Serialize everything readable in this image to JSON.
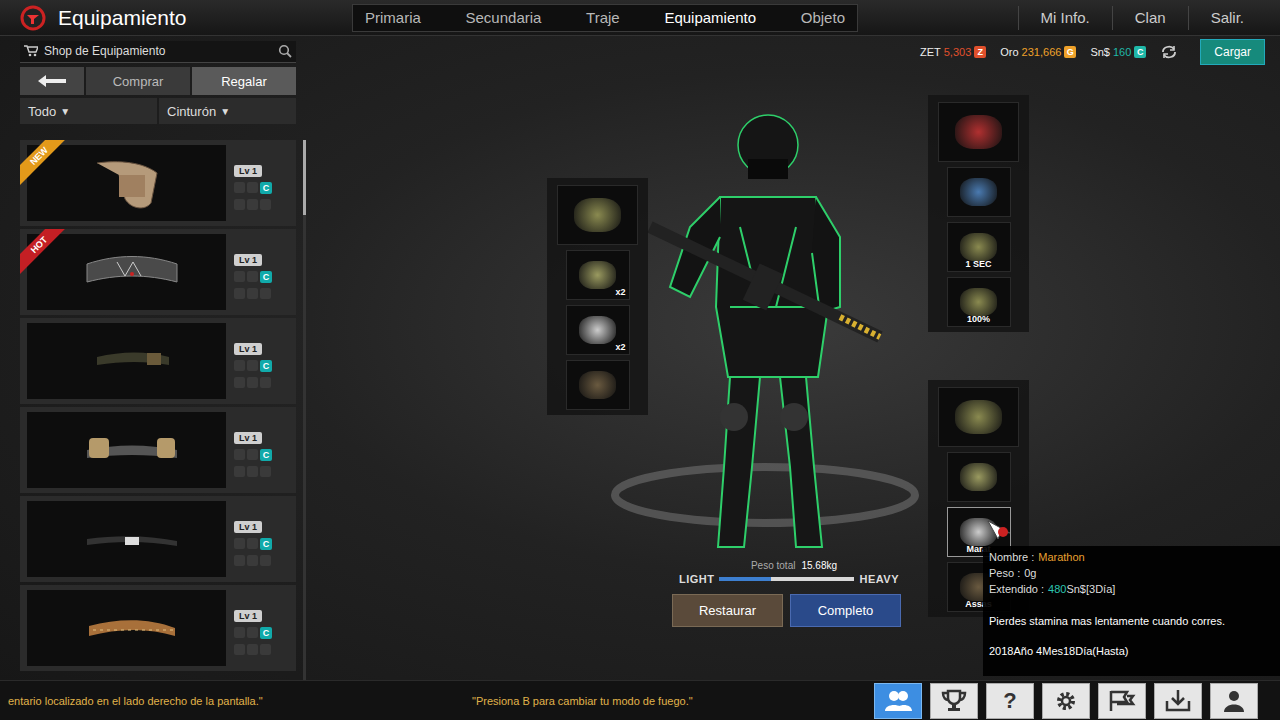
{
  "header": {
    "title": "Equipamiento"
  },
  "tabs": [
    {
      "label": "Primaria",
      "selected": false
    },
    {
      "label": "Secundaria",
      "selected": false
    },
    {
      "label": "Traje",
      "selected": false
    },
    {
      "label": "Equipamiento",
      "selected": true
    },
    {
      "label": "Objeto",
      "selected": false
    }
  ],
  "menu": [
    "Mi Info.",
    "Clan",
    "Salir."
  ],
  "search": {
    "value": "Shop de Equipamiento"
  },
  "currencies": [
    {
      "label": "ZET",
      "amount": "5,303",
      "symbol": "Z",
      "color": "#e0502c"
    },
    {
      "label": "Oro",
      "amount": "231,666",
      "symbol": "G",
      "color": "#eea12a"
    },
    {
      "label": "Sn$",
      "amount": "160",
      "symbol": "C",
      "color": "#1fb8a8"
    }
  ],
  "load_button": "Cargar",
  "shop_actions": [
    {
      "label": "Comprar",
      "selected": false
    },
    {
      "label": "Regalar",
      "selected": true
    }
  ],
  "filters": [
    {
      "label": "Todo",
      "arrow": "▼"
    },
    {
      "label": "Cinturón",
      "arrow": "▼"
    }
  ],
  "items": [
    {
      "badge": "NEW",
      "level": "Lv 1",
      "currency": "C"
    },
    {
      "badge": "HOT",
      "level": "Lv 1",
      "currency": "C"
    },
    {
      "level": "Lv 1",
      "currency": "C"
    },
    {
      "level": "Lv 1",
      "currency": "C"
    },
    {
      "level": "Lv 1",
      "currency": "C"
    },
    {
      "level": "Lv 1",
      "currency": "C"
    }
  ],
  "slots_left": [
    {},
    {
      "label": "x2"
    },
    {
      "label": "x2"
    },
    {}
  ],
  "slots_right_top": [
    {},
    {},
    {
      "label": "1 SEC"
    },
    {
      "label": "100%"
    }
  ],
  "slots_right_bottom": [
    {
      "hovered": false
    },
    {
      "hovered": false
    },
    {
      "label": "Marat",
      "hovered": true
    },
    {
      "label": "Assas",
      "hovered": false
    }
  ],
  "weight": {
    "label": "Peso total",
    "value": "15.68kg",
    "light": "LIGHT",
    "heavy": "HEAVY",
    "level": 0.38
  },
  "buttons": [
    {
      "label": "Restaurar",
      "kind": "restore"
    },
    {
      "label": "Completo",
      "kind": "confirm"
    }
  ],
  "tooltip": {
    "rows": [
      {
        "key": "Nombre  :",
        "value": "Marathon"
      },
      {
        "key": "Peso :",
        "value": "0g"
      },
      {
        "key": "Extendido :",
        "value": "480",
        "suffix": "Sn$[3Día]"
      }
    ],
    "description": "Pierdes stamina mas lentamente cuando corres.",
    "expiry": "2018Año 4Mes18Día(Hasta)"
  },
  "ticker": [
    "entario localizado en el lado derecho de la pantalla.\"",
    "\"Presiona B para cambiar tu modo de fuego.\""
  ],
  "bottom_icons": [
    {
      "kind": "friends",
      "selected": true
    },
    {
      "kind": "trophy",
      "selected": false
    },
    {
      "kind": "help",
      "glyph": "?",
      "selected": false
    },
    {
      "kind": "settings",
      "selected": false
    },
    {
      "kind": "clan",
      "selected": false
    },
    {
      "kind": "download",
      "selected": false
    },
    {
      "kind": "profile",
      "selected": false
    }
  ]
}
